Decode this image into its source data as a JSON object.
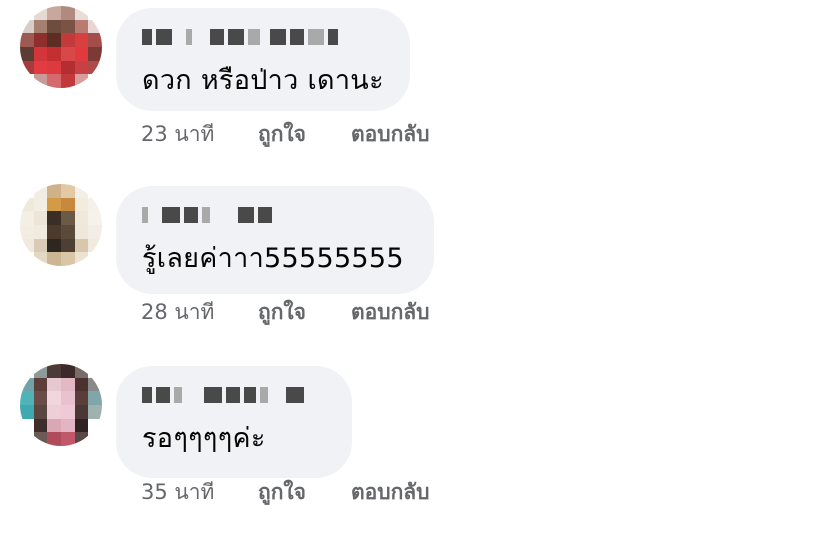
{
  "comments": [
    {
      "text": "ดวก หรือป่าว เดานะ",
      "time": "23 นาที",
      "like_label": "ถูกใจ",
      "reply_label": "ตอบกลับ",
      "avatar_colors": [
        "#fff",
        "#e6d9d4",
        "#c8a89c",
        "#b08a7e",
        "#e8dcd8",
        "#fff",
        "#d9cdca",
        "#a38070",
        "#6e4d3e",
        "#7a5344",
        "#b77b71",
        "#e7d6d2",
        "#9b5a52",
        "#8e2e2d",
        "#5d2c23",
        "#c33a3a",
        "#d84040",
        "#a44d4a",
        "#5c3b33",
        "#d3353a",
        "#c43032",
        "#d84848",
        "#e03a3e",
        "#7b3a36",
        "#a53b3a",
        "#e13c42",
        "#dc3a3f",
        "#b32d31",
        "#c84046",
        "#b04a48",
        "#fff",
        "#c99a98",
        "#d46a6d",
        "#c2393c",
        "#d79e9c",
        "#fff"
      ]
    },
    {
      "text": "รู้เลยค่าาา55555555",
      "time": "28 นาที",
      "like_label": "ถูกใจ",
      "reply_label": "ตอบกลับ",
      "avatar_colors": [
        "#fff",
        "#f2ede2",
        "#cfb28a",
        "#e0c9a3",
        "#f4efe6",
        "#fff",
        "#efe9dc",
        "#f3eee3",
        "#d49b46",
        "#c7893e",
        "#f2ecdf",
        "#f6f1e8",
        "#f4efe5",
        "#ede6d8",
        "#3b2f25",
        "#6b5a46",
        "#efe8db",
        "#f6f2ea",
        "#f2ece1",
        "#f0eadf",
        "#4c3b2c",
        "#5a4a3a",
        "#eee7da",
        "#f3eee5",
        "#f0e9dd",
        "#d9cbb5",
        "#2e2620",
        "#4d3f33",
        "#d8c7ad",
        "#f1ebdf",
        "#fff",
        "#e5d8c2",
        "#cdb693",
        "#d9c6a6",
        "#ece3d2",
        "#fff"
      ]
    },
    {
      "text": "รอๆๆๆๆค่ะ",
      "time": "35 นาที",
      "like_label": "ถูกใจ",
      "reply_label": "ตอบกลับ",
      "avatar_colors": [
        "#fff",
        "#8d9a98",
        "#4a3b36",
        "#3b2a27",
        "#7a6b66",
        "#fff",
        "#6fa3a8",
        "#5c3f3a",
        "#e8c8d0",
        "#e2b8c4",
        "#4a3230",
        "#8a8a8a",
        "#4fb3b8",
        "#6a4c48",
        "#f1d6de",
        "#e9c2cf",
        "#5b3d3a",
        "#7fa7aa",
        "#3fa9b0",
        "#5a4541",
        "#eecfd8",
        "#efcad6",
        "#4b3836",
        "#9fb2b0",
        "#fff",
        "#3e2e2b",
        "#d9a7b6",
        "#e3b4c3",
        "#2f2322",
        "#fff",
        "#fff",
        "#6c5a56",
        "#b04b5c",
        "#c15869",
        "#5a4844",
        "#fff"
      ]
    }
  ]
}
